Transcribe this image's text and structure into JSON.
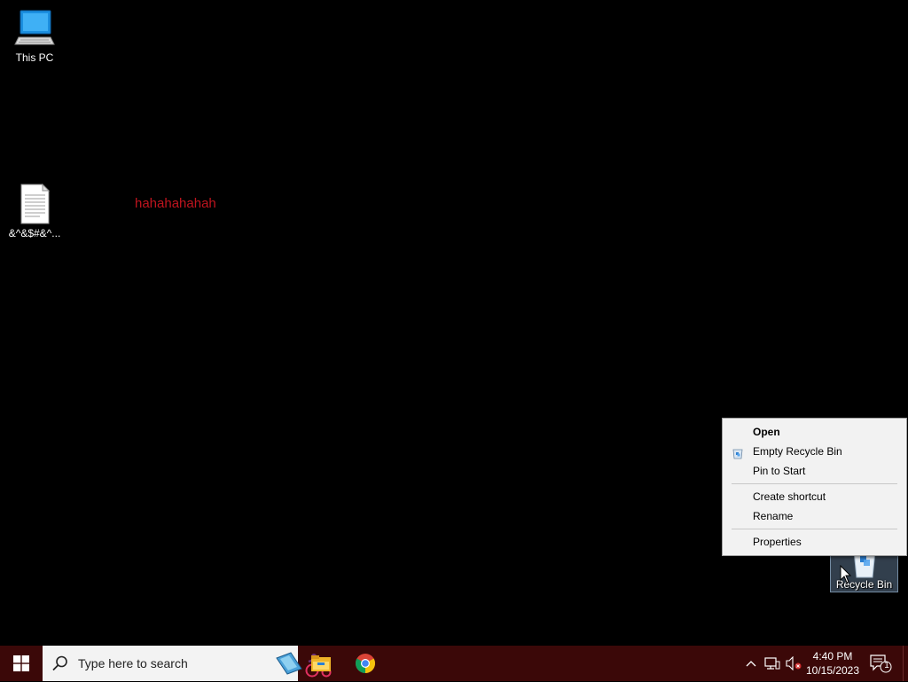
{
  "desktop": {
    "icons": [
      {
        "label": "This PC",
        "icon": "this-pc-icon"
      },
      {
        "label": "&^&$#&^...",
        "icon": "text-document-icon"
      },
      {
        "label": "Recycle Bin",
        "icon": "recycle-bin-icon",
        "selected": true
      }
    ],
    "overlay_text": "hahahahahah",
    "overlay_text_color": "#c0141e"
  },
  "context_menu": {
    "items": [
      {
        "label": "Open",
        "bold": true
      },
      {
        "label": "Empty Recycle Bin",
        "icon": "recycle-bin-small-icon"
      },
      {
        "label": "Pin to Start"
      },
      {
        "separator": true
      },
      {
        "label": "Create shortcut"
      },
      {
        "label": "Rename"
      },
      {
        "separator": true
      },
      {
        "label": "Properties"
      }
    ]
  },
  "taskbar": {
    "background": "#3b0808",
    "search_placeholder": "Type here to search",
    "pinned_apps": [
      {
        "name": "File Explorer",
        "icon": "file-explorer-icon"
      },
      {
        "name": "Google Chrome",
        "icon": "chrome-icon"
      }
    ],
    "tray": {
      "time": "4:40 PM",
      "date": "10/15/2023",
      "notification_count": "1"
    }
  }
}
